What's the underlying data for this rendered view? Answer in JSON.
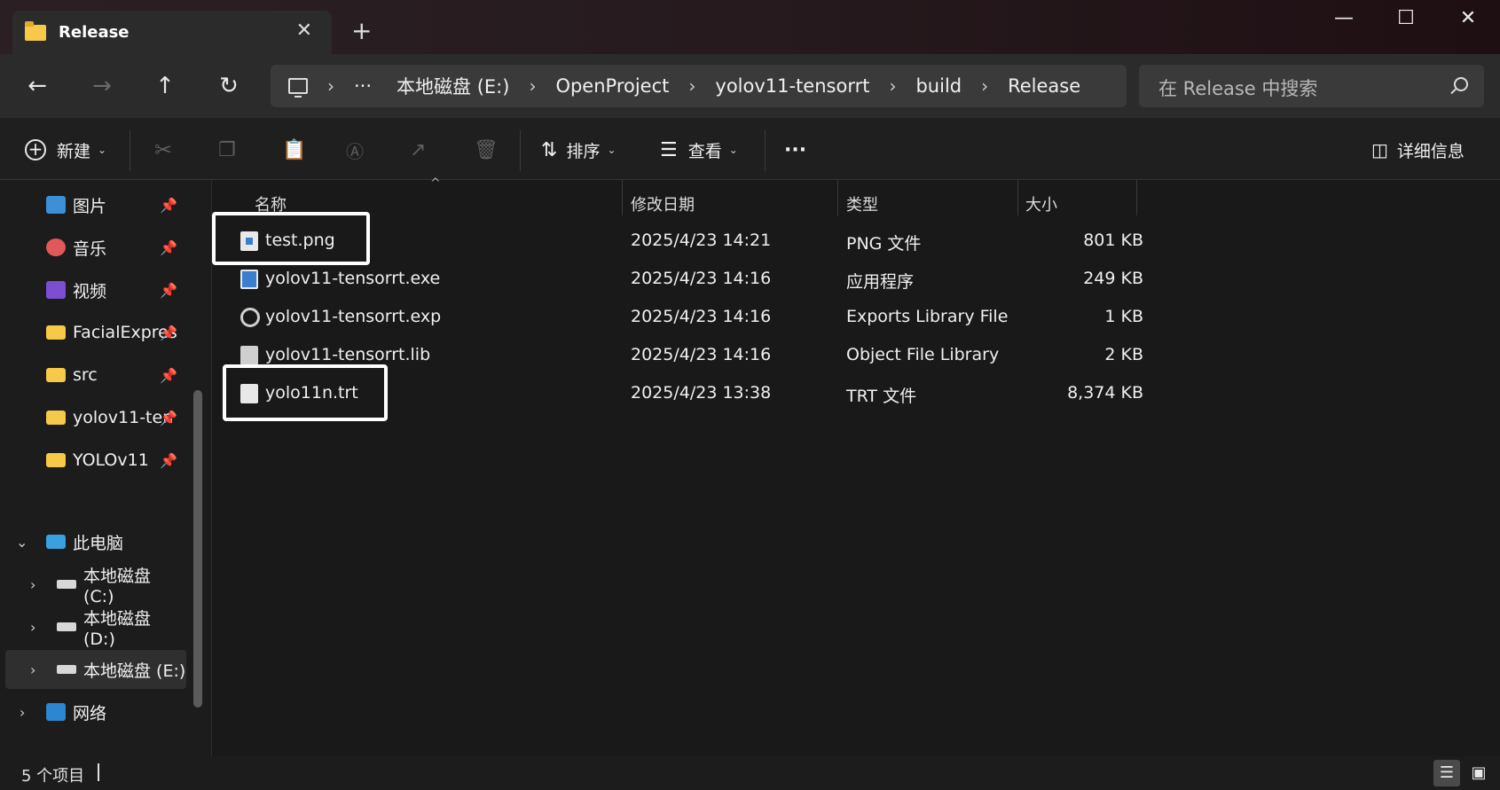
{
  "window": {
    "tab_title": "Release",
    "new_tab": "+",
    "close_tab": "✕",
    "minimize": "—",
    "maximize": "☐",
    "close": "✕"
  },
  "nav": {
    "back": "←",
    "forward": "→",
    "up": "↑",
    "refresh": "↻"
  },
  "breadcrumb": {
    "more": "···",
    "items": [
      "本地磁盘 (E:)",
      "OpenProject",
      "yolov11-tensorrt",
      "build",
      "Release"
    ]
  },
  "search": {
    "placeholder": "在 Release 中搜索"
  },
  "toolbar": {
    "new": "新建",
    "sort": "排序",
    "view": "查看",
    "more": "···",
    "details": "详细信息"
  },
  "sidebar": {
    "pinned": [
      {
        "label": "图片",
        "icon": "pictures-icon"
      },
      {
        "label": "音乐",
        "icon": "music-icon"
      },
      {
        "label": "视频",
        "icon": "videos-icon"
      },
      {
        "label": "FacialExpres",
        "icon": "folder-icon"
      },
      {
        "label": "src",
        "icon": "folder-icon"
      },
      {
        "label": "yolov11-ten",
        "icon": "folder-icon"
      },
      {
        "label": "YOLOv11",
        "icon": "folder-icon"
      }
    ],
    "this_pc": "此电脑",
    "drives": [
      "本地磁盘 (C:)",
      "本地磁盘 (D:)",
      "本地磁盘 (E:)"
    ],
    "network": "网络"
  },
  "columns": {
    "name": "名称",
    "date": "修改日期",
    "type": "类型",
    "size": "大小"
  },
  "files": [
    {
      "name": "test.png",
      "date": "2025/4/23 14:21",
      "type": "PNG 文件",
      "size": "801 KB",
      "icon": "image-file-icon"
    },
    {
      "name": "yolov11-tensorrt.exe",
      "date": "2025/4/23 14:16",
      "type": "应用程序",
      "size": "249 KB",
      "icon": "exe-file-icon"
    },
    {
      "name": "yolov11-tensorrt.exp",
      "date": "2025/4/23 14:16",
      "type": "Exports Library File",
      "size": "1 KB",
      "icon": "exp-file-icon"
    },
    {
      "name": "yolov11-tensorrt.lib",
      "date": "2025/4/23 14:16",
      "type": "Object File Library",
      "size": "2 KB",
      "icon": "lib-file-icon"
    },
    {
      "name": "yolo11n.trt",
      "date": "2025/4/23 13:38",
      "type": "TRT 文件",
      "size": "8,374 KB",
      "icon": "generic-file-icon"
    }
  ],
  "status": {
    "count": "5 个项目"
  },
  "colors": {
    "highlight_box": "#ffffff",
    "folder": "#f7c948"
  }
}
